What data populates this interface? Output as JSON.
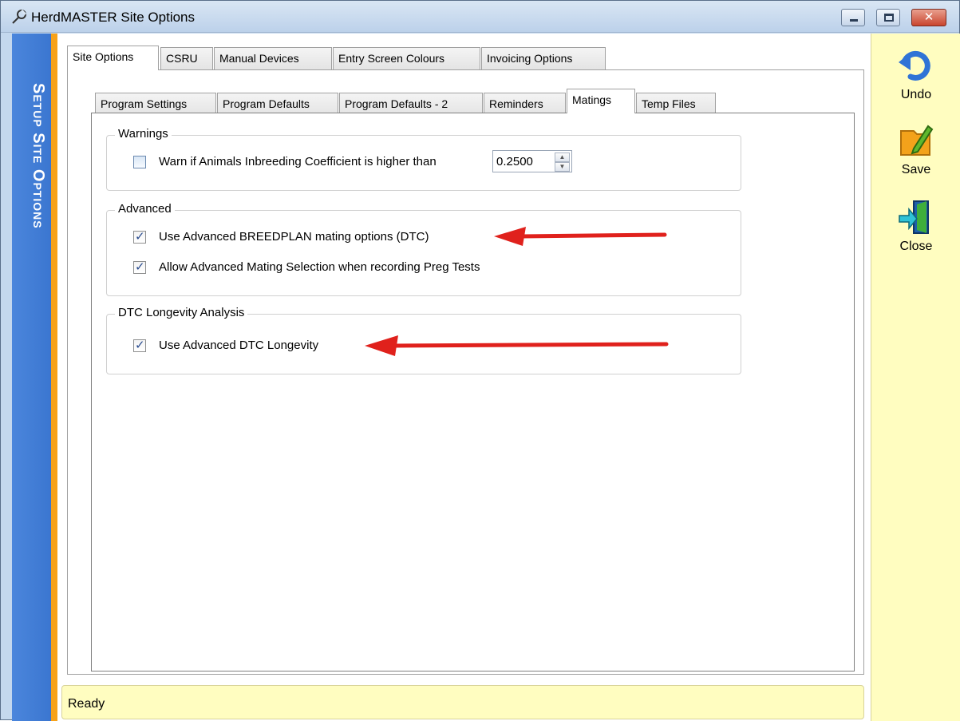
{
  "window": {
    "title": "HerdMASTER Site Options",
    "buttons": {
      "minimize": "minimize",
      "maximize": "maximize",
      "close": "✕"
    }
  },
  "sidebar": {
    "title": "Setup Site Options"
  },
  "top_tabs": [
    {
      "label": "Site Options",
      "active": true
    },
    {
      "label": "CSRU",
      "active": false
    },
    {
      "label": "Manual Devices",
      "active": false
    },
    {
      "label": "Entry Screen Colours",
      "active": false
    },
    {
      "label": "Invoicing Options",
      "active": false
    }
  ],
  "sub_tabs": [
    {
      "label": "Program Settings",
      "active": false
    },
    {
      "label": "Program Defaults",
      "active": false
    },
    {
      "label": "Program Defaults - 2",
      "active": false
    },
    {
      "label": "Reminders",
      "active": false
    },
    {
      "label": "Matings",
      "active": true
    },
    {
      "label": "Temp Files",
      "active": false
    }
  ],
  "groups": {
    "warnings": {
      "title": "Warnings",
      "inbreeding_label": "Warn if Animals Inbreeding Coefficient is higher than",
      "inbreeding_checked": false,
      "inbreeding_value": "0.2500"
    },
    "advanced": {
      "title": "Advanced",
      "breedplan_label": "Use Advanced BREEDPLAN mating options (DTC)",
      "breedplan_checked": true,
      "preg_label": "Allow Advanced Mating Selection when recording Preg Tests",
      "preg_checked": true
    },
    "longevity": {
      "title": "DTC Longevity Analysis",
      "longevity_label": "Use Advanced DTC Longevity",
      "longevity_checked": true
    }
  },
  "toolbar": {
    "undo": "Undo",
    "save": "Save",
    "close": "Close"
  },
  "status": {
    "text": "Ready"
  },
  "colors": {
    "accent_blue": "#3b76d0",
    "accent_orange": "#f7a21a",
    "toolbar_bg": "#fffdc0",
    "arrow_red": "#e0211c"
  }
}
